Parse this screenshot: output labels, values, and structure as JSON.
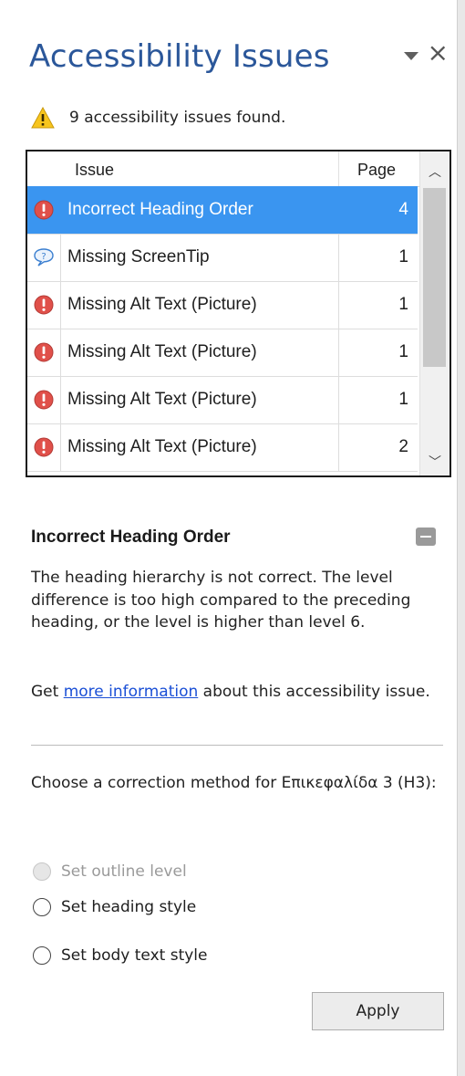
{
  "pane": {
    "title": "Accessibility Issues",
    "close_glyph": "×",
    "summary_text": "9  accessibility issues found."
  },
  "table": {
    "headers": {
      "issue": "Issue",
      "page": "Page"
    },
    "rows": [
      {
        "icon": "error-icon",
        "issue": "Incorrect Heading Order",
        "page": "4",
        "selected": true
      },
      {
        "icon": "tip-icon",
        "issue": "Missing ScreenTip",
        "page": "1",
        "selected": false
      },
      {
        "icon": "error-icon",
        "issue": "Missing Alt Text (Picture)",
        "page": "1",
        "selected": false
      },
      {
        "icon": "error-icon",
        "issue": "Missing Alt Text (Picture)",
        "page": "1",
        "selected": false
      },
      {
        "icon": "error-icon",
        "issue": "Missing Alt Text (Picture)",
        "page": "1",
        "selected": false
      },
      {
        "icon": "error-icon",
        "issue": "Missing Alt Text (Picture)",
        "page": "2",
        "selected": false
      }
    ]
  },
  "detail": {
    "title": "Incorrect Heading Order",
    "description": "The heading hierarchy is not correct. The level difference is too high compared to the preceding heading, or the level is higher than level 6.",
    "more_prefix": "Get ",
    "more_link": "more information",
    "more_suffix": " about this accessibility issue.",
    "choose_text": "Choose a correction method for Επικεφαλίδα 3 (H3):",
    "options": [
      {
        "label": "Set outline level",
        "disabled": true
      },
      {
        "label": "Set heading style",
        "disabled": false
      },
      {
        "label": "Set body text style",
        "disabled": false
      }
    ],
    "apply_label": "Apply"
  },
  "colors": {
    "title": "#2b579a",
    "selected_row": "#3a95f0",
    "link": "#1a4fd6",
    "error_icon": "#e0504a",
    "tip_icon": "#3b7fd0"
  }
}
